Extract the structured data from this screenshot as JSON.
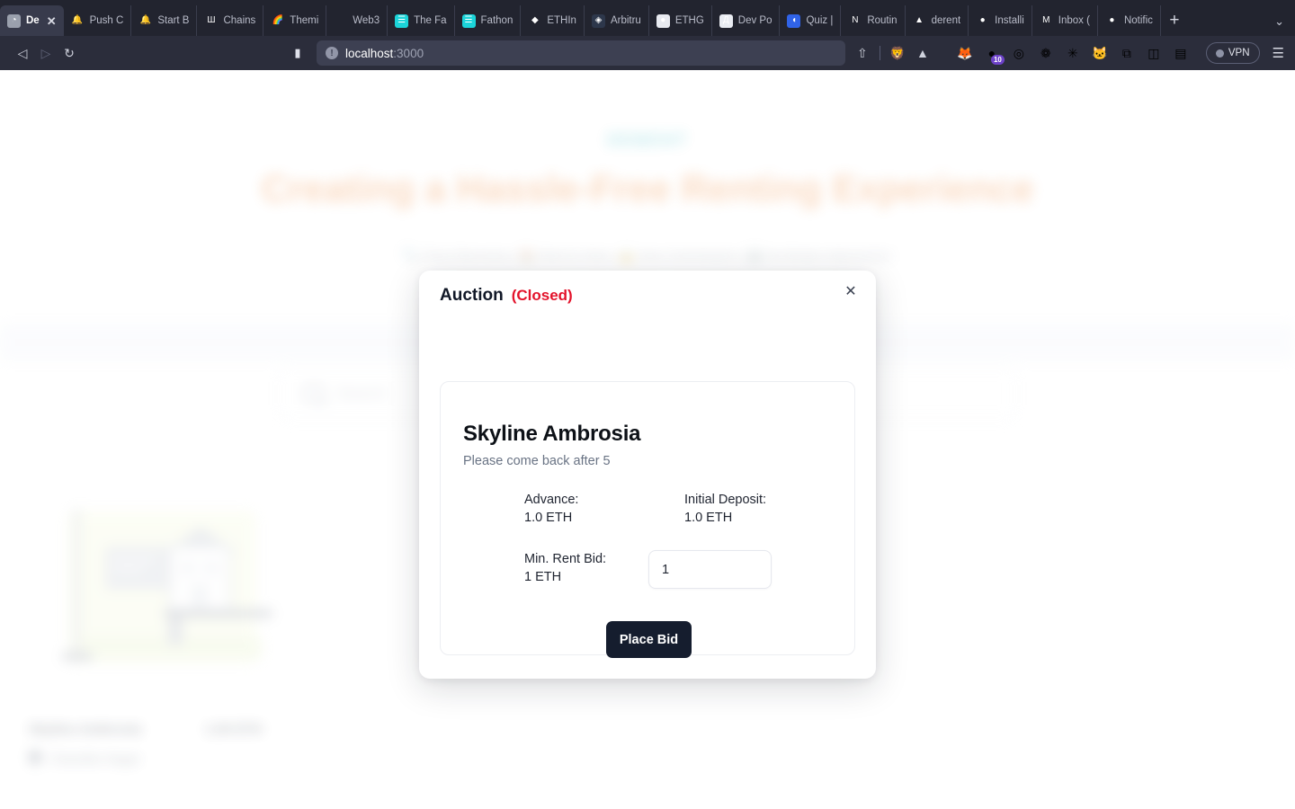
{
  "browser": {
    "tabs": [
      {
        "label": "De",
        "icon": "globe-icon",
        "icon_glyph": "◔",
        "icon_bg": "#9aa0ad",
        "active": true,
        "has_close": true
      },
      {
        "label": "Push C",
        "icon": "bell-icon",
        "icon_glyph": "🔔",
        "icon_bg": "transparent",
        "active": false
      },
      {
        "label": "Start B",
        "icon": "bell-icon",
        "icon_glyph": "🔔",
        "icon_bg": "transparent",
        "active": false
      },
      {
        "label": "Chains",
        "icon": "chainstack-icon",
        "icon_glyph": "Ш",
        "icon_bg": "transparent",
        "active": false
      },
      {
        "label": "Themi",
        "icon": "rainbow-icon",
        "icon_glyph": "🌈",
        "icon_bg": "transparent",
        "active": false
      },
      {
        "label": "Web3",
        "icon": "blank-icon",
        "icon_glyph": "",
        "icon_bg": "transparent",
        "active": false
      },
      {
        "label": "The Fa",
        "icon": "book-icon",
        "icon_glyph": "☰",
        "icon_bg": "#1bd4d9",
        "active": false
      },
      {
        "label": "Fathon",
        "icon": "book-icon",
        "icon_glyph": "☰",
        "icon_bg": "#1bd4d9",
        "active": false
      },
      {
        "label": "ETHIn",
        "icon": "ethereum-icon",
        "icon_glyph": "◆",
        "icon_bg": "transparent",
        "active": false
      },
      {
        "label": "Arbitru",
        "icon": "arbitrum-icon",
        "icon_glyph": "◈",
        "icon_bg": "#2d374b",
        "active": false
      },
      {
        "label": "ETHG",
        "icon": "ethglobal-icon",
        "icon_glyph": "●",
        "icon_bg": "#e8eaf0",
        "active": false
      },
      {
        "label": "Dev Po",
        "icon": "devpost-icon",
        "icon_glyph": "Д",
        "icon_bg": "#e9ecf2",
        "active": false
      },
      {
        "label": "Quiz |",
        "icon": "quiz-icon",
        "icon_glyph": "◖",
        "icon_bg": "#3063e8",
        "active": false
      },
      {
        "label": "Routin",
        "icon": "notion-icon",
        "icon_glyph": "N",
        "icon_bg": "transparent",
        "active": false
      },
      {
        "label": "derent",
        "icon": "vercel-icon",
        "icon_glyph": "▲",
        "icon_bg": "transparent",
        "active": false
      },
      {
        "label": "Installi",
        "icon": "github-icon",
        "icon_glyph": "●",
        "icon_bg": "transparent",
        "active": false
      },
      {
        "label": "Inbox (",
        "icon": "gmail-icon",
        "icon_glyph": "M",
        "icon_bg": "transparent",
        "active": false
      },
      {
        "label": "Notific",
        "icon": "github-icon",
        "icon_glyph": "●",
        "icon_bg": "transparent",
        "active": false
      }
    ],
    "new_tab_label": "+",
    "tab_list_label": "⌄",
    "nav": {
      "back_label": "◁",
      "forward_label": "▷",
      "reload_label": "↻",
      "bookmark_label": "▮",
      "site_info_label": "!",
      "url_prefix": "localhost",
      "url_suffix": ":3000",
      "share_label": "⇧",
      "brave_label": "🦁",
      "shield_label": "▲"
    },
    "extensions": [
      {
        "name": "metamask-icon",
        "glyph": "🦊",
        "badge": ""
      },
      {
        "name": "phantom-icon",
        "glyph": "●",
        "badge": "10"
      },
      {
        "name": "rabby-icon",
        "glyph": "◎",
        "badge": ""
      },
      {
        "name": "colorpicker-icon",
        "glyph": "❁",
        "badge": ""
      },
      {
        "name": "claude-icon",
        "glyph": "✳",
        "badge": ""
      },
      {
        "name": "kitty-icon",
        "glyph": "🐱",
        "badge": ""
      },
      {
        "name": "puzzle-icon",
        "glyph": "⧉",
        "badge": ""
      },
      {
        "name": "sidebar-icon",
        "glyph": "◫",
        "badge": ""
      },
      {
        "name": "wallet-icon",
        "glyph": "▤",
        "badge": ""
      }
    ],
    "vpn_label": "VPN",
    "menu_label": "☰"
  },
  "page": {
    "brand": "DEBENT",
    "hero_title": "Creating a Hassle-Free Renting Experience",
    "hero_subtitle": "🔍 Price Discovery | 🏠 Rent to Own | 🔒 Zero Commission | 🏢 No Broker Intervention",
    "search_placeholder": "Search",
    "search_value": "",
    "listing": {
      "title": "Skyline Ambrosia",
      "price": "1.00 ETH",
      "location": "Charolles Nagar"
    }
  },
  "modal": {
    "title": "Auction",
    "status": "(Closed)",
    "close_label": "✕",
    "property_name": "Skyline Ambrosia",
    "note": "Please come back after 5",
    "details": [
      {
        "label": "Advance:",
        "value": "1.0 ETH"
      },
      {
        "label": "Initial Deposit:",
        "value": "1.0 ETH"
      }
    ],
    "bid": {
      "label": "Min. Rent Bid:",
      "value": "1 ETH",
      "input_value": "1",
      "input_placeholder": "1"
    },
    "submit_label": "Place Bid"
  },
  "colors": {
    "status_red": "#e3132b",
    "button_dark": "#151d2e",
    "brand_teal": "#27b3bf",
    "hero_orange": "#f08a3c"
  }
}
